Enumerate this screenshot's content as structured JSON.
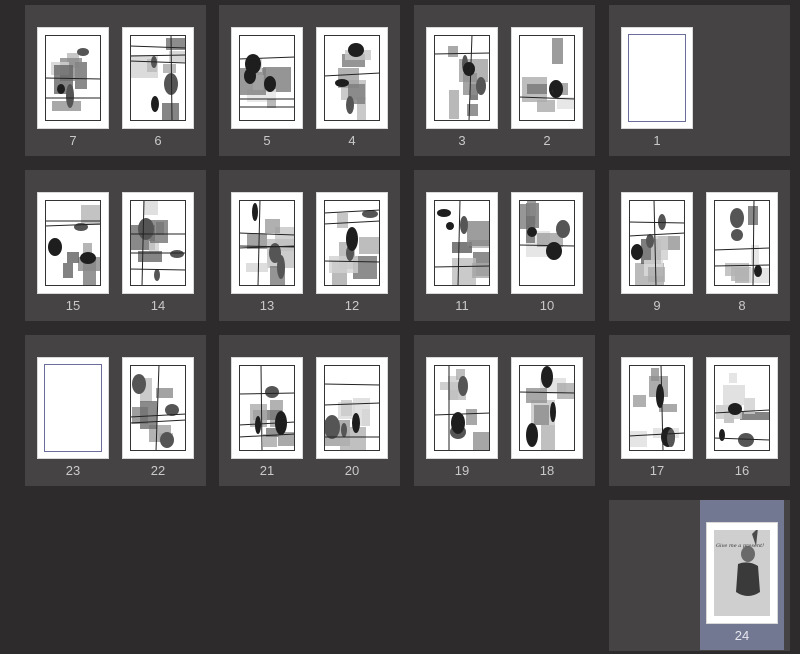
{
  "spreads": [
    {
      "pages": [
        {
          "number": "7",
          "kind": "manga"
        },
        {
          "number": "6",
          "kind": "manga"
        }
      ]
    },
    {
      "pages": [
        {
          "number": "5",
          "kind": "manga"
        },
        {
          "number": "4",
          "kind": "manga"
        }
      ]
    },
    {
      "pages": [
        {
          "number": "3",
          "kind": "manga"
        },
        {
          "number": "2",
          "kind": "manga"
        }
      ]
    },
    {
      "pages": [
        {
          "number": "1",
          "kind": "blank"
        }
      ]
    },
    {
      "pages": [
        {
          "number": "15",
          "kind": "manga"
        },
        {
          "number": "14",
          "kind": "manga"
        }
      ]
    },
    {
      "pages": [
        {
          "number": "13",
          "kind": "manga"
        },
        {
          "number": "12",
          "kind": "manga"
        }
      ]
    },
    {
      "pages": [
        {
          "number": "11",
          "kind": "manga"
        },
        {
          "number": "10",
          "kind": "manga"
        }
      ]
    },
    {
      "pages": [
        {
          "number": "9",
          "kind": "manga"
        },
        {
          "number": "8",
          "kind": "manga"
        }
      ]
    },
    {
      "pages": [
        {
          "number": "23",
          "kind": "blank"
        },
        {
          "number": "22",
          "kind": "manga"
        }
      ]
    },
    {
      "pages": [
        {
          "number": "21",
          "kind": "manga"
        },
        {
          "number": "20",
          "kind": "manga"
        }
      ]
    },
    {
      "pages": [
        {
          "number": "19",
          "kind": "manga"
        },
        {
          "number": "18",
          "kind": "manga"
        }
      ]
    },
    {
      "pages": [
        {
          "number": "17",
          "kind": "manga"
        },
        {
          "number": "16",
          "kind": "manga"
        }
      ]
    },
    {
      "pages": [
        {
          "number": "24",
          "kind": "cover",
          "selected": true,
          "cover_text": "Give me a present!"
        }
      ]
    }
  ],
  "colors": {
    "background": "#2d2b2c",
    "spread": "#454344",
    "selection": "#737892",
    "page_number": "#c9c9c9"
  }
}
